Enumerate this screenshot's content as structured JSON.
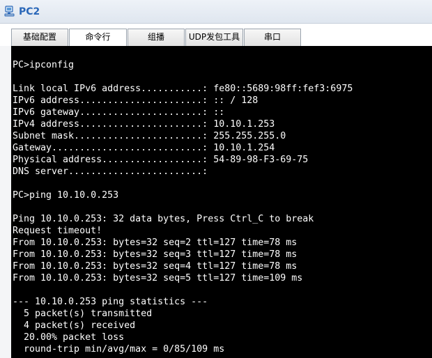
{
  "window": {
    "title": "PC2",
    "icon": "pc-icon"
  },
  "tabs": [
    {
      "label": "基础配置",
      "active": false
    },
    {
      "label": "命令行",
      "active": true
    },
    {
      "label": "组播",
      "active": false
    },
    {
      "label": "UDP发包工具",
      "active": false
    },
    {
      "label": "串口",
      "active": false
    }
  ],
  "terminal": {
    "lines": [
      "PC>ipconfig",
      "",
      "Link local IPv6 address...........: fe80::5689:98ff:fef3:6975",
      "IPv6 address......................: :: / 128",
      "IPv6 gateway......................: ::",
      "IPv4 address......................: 10.10.1.253",
      "Subnet mask.......................: 255.255.255.0",
      "Gateway...........................: 10.10.1.254",
      "Physical address..................: 54-89-98-F3-69-75",
      "DNS server........................:",
      "",
      "PC>ping 10.10.0.253",
      "",
      "Ping 10.10.0.253: 32 data bytes, Press Ctrl_C to break",
      "Request timeout!",
      "From 10.10.0.253: bytes=32 seq=2 ttl=127 time=78 ms",
      "From 10.10.0.253: bytes=32 seq=3 ttl=127 time=78 ms",
      "From 10.10.0.253: bytes=32 seq=4 ttl=127 time=78 ms",
      "From 10.10.0.253: bytes=32 seq=5 ttl=127 time=109 ms",
      "",
      "--- 10.10.0.253 ping statistics ---",
      "  5 packet(s) transmitted",
      "  4 packet(s) received",
      "  20.00% packet loss",
      "  round-trip min/avg/max = 0/85/109 ms"
    ]
  }
}
